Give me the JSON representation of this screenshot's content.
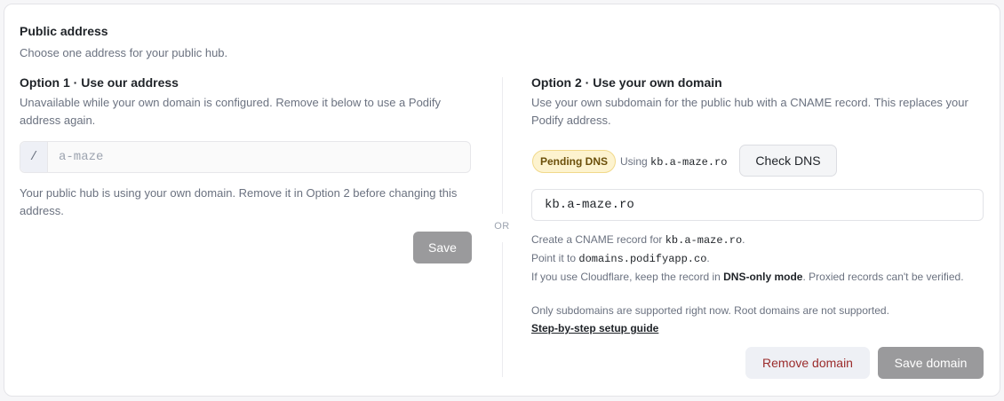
{
  "header": {
    "title": "Public address",
    "subtitle": "Choose one address for your public hub."
  },
  "option1": {
    "title": "Option 1 · Use our address",
    "description": "Unavailable while your own domain is configured. Remove it below to use a Podify address again.",
    "prefix": "/",
    "placeholder": "a-maze",
    "note": "Your public hub is using your own domain. Remove it in Option 2 before changing this address.",
    "save_label": "Save"
  },
  "divider": {
    "label": "OR"
  },
  "option2": {
    "title": "Option 2 · Use your own domain",
    "description": "Use your own subdomain for the public hub with a CNAME record. This replaces your Podify address.",
    "status_badge": "Pending DNS",
    "using_label": "Using",
    "using_domain": "kb.a-maze.ro",
    "check_dns_label": "Check DNS",
    "domain_value": "kb.a-maze.ro",
    "instructions": {
      "cname_prefix": "Create a CNAME record for",
      "cname_domain": "kb.a-maze.ro",
      "cname_suffix": ".",
      "point_prefix": "Point it to",
      "point_target": "domains.podifyapp.co",
      "point_suffix": ".",
      "cloudflare_prefix": "If you use Cloudflare, keep the record in",
      "cloudflare_mode": "DNS-only mode",
      "cloudflare_suffix": ". Proxied records can't be verified.",
      "subdomain_note": "Only subdomains are supported right now. Root domains are not supported."
    },
    "guide_link": "Step-by-step setup guide",
    "remove_label": "Remove domain",
    "save_label": "Save domain"
  },
  "colors": {
    "badge_bg": "#fdf3cf",
    "badge_text": "#6b4f0a",
    "remove_text": "#9b2c2c",
    "disabled_button": "#9a9a9c"
  }
}
